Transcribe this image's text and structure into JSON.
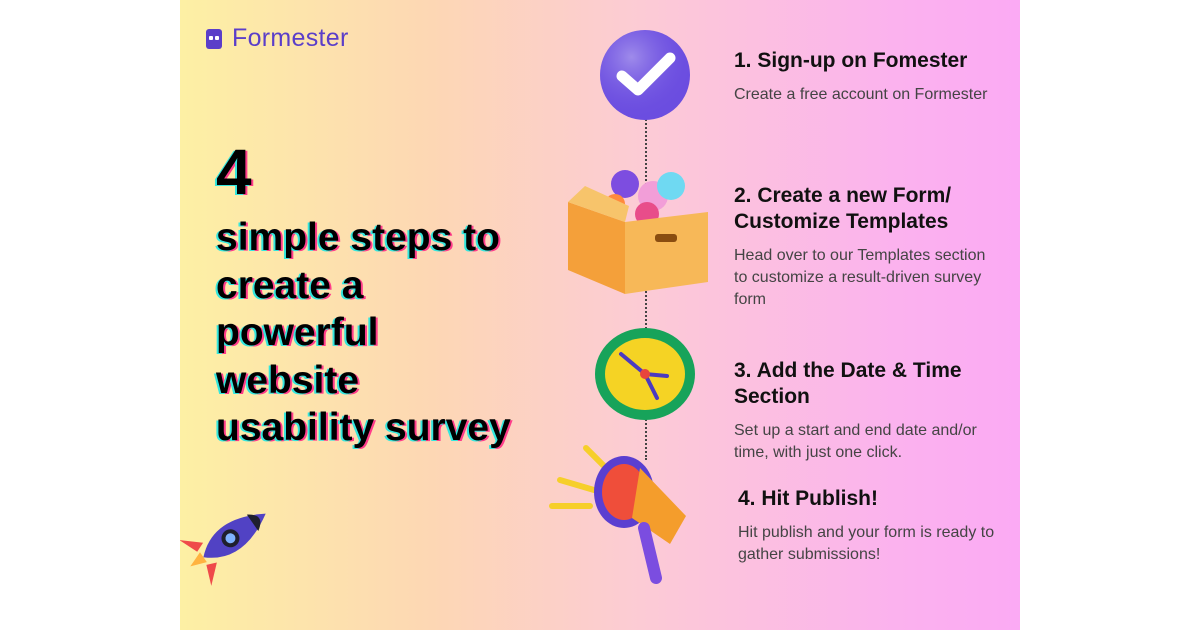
{
  "brand": {
    "name": "Formester",
    "icon": "formester-logo-icon"
  },
  "headline": {
    "number": "4",
    "text": "simple steps to create a powerful website usability survey"
  },
  "steps": [
    {
      "title": "1. Sign-up on Fomester",
      "description": "Create a free account on Formester",
      "icon": "checkmark-icon"
    },
    {
      "title": "2. Create a new Form/ Customize Templates",
      "description": "Head over to our Templates section to customize a result-driven survey form",
      "icon": "box-icon"
    },
    {
      "title": "3. Add the Date & Time Section",
      "description": "Set up a start and end date and/or time, with just one click.",
      "icon": "clock-icon"
    },
    {
      "title": "4. Hit Publish!",
      "description": "Hit publish and your form is ready to gather submissions!",
      "icon": "megaphone-icon"
    }
  ],
  "colors": {
    "brand": "#5b3ec9",
    "gradient_left": "#fdf0a4",
    "gradient_right": "#fbaaf4",
    "shadow_cyan": "#34e6dd",
    "shadow_pink": "#ff3c8a"
  }
}
